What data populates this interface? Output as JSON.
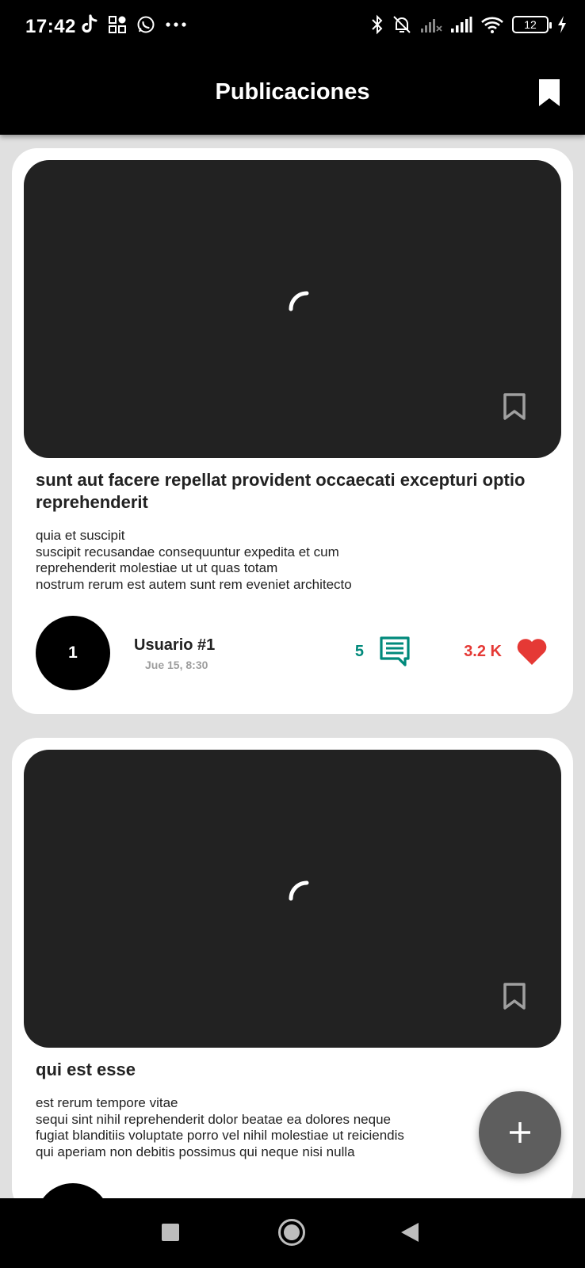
{
  "status_bar": {
    "time": "17:42",
    "battery": "12",
    "left_icons": [
      "tiktok-icon",
      "grid-apps-icon",
      "whatsapp-icon",
      "more-dots-icon"
    ],
    "right_icons": [
      "bluetooth-icon",
      "bell-off-icon",
      "signal-weak-icon",
      "signal-icon",
      "wifi-icon",
      "battery-icon",
      "charging-icon"
    ]
  },
  "app_bar": {
    "title": "Publicaciones",
    "action_icon": "bookmark-icon"
  },
  "posts": [
    {
      "title": "sunt aut facere repellat provident occaecati excepturi optio reprehenderit",
      "body": "quia et suscipit\nsuscipit recusandae consequuntur expedita et cum\nreprehenderit molestiae ut ut quas totam\nnostrum rerum est autem sunt rem eveniet architecto",
      "avatar_text": "1",
      "user": "Usuario #1",
      "date": "Jue 15, 8:30",
      "comments": "5",
      "likes": "3.2 K"
    },
    {
      "title": "qui est esse",
      "body": "est rerum tempore vitae\nsequi sint nihil reprehenderit dolor beatae ea dolores neque\nfugiat blanditiis voluptate porro vel nihil molestiae ut reiciendis\nqui aperiam non debitis possimus qui neque nisi nulla"
    }
  ],
  "fab": {
    "icon": "plus-icon"
  },
  "nav_bar": {
    "icons": [
      "recents-icon",
      "home-icon",
      "back-icon"
    ]
  },
  "colors": {
    "app_bar": "#000000",
    "background": "#e0e0e0",
    "image_placeholder": "#222222",
    "comment_accent": "#00897b",
    "like_accent": "#e53935",
    "fab": "#5e5e5e"
  }
}
